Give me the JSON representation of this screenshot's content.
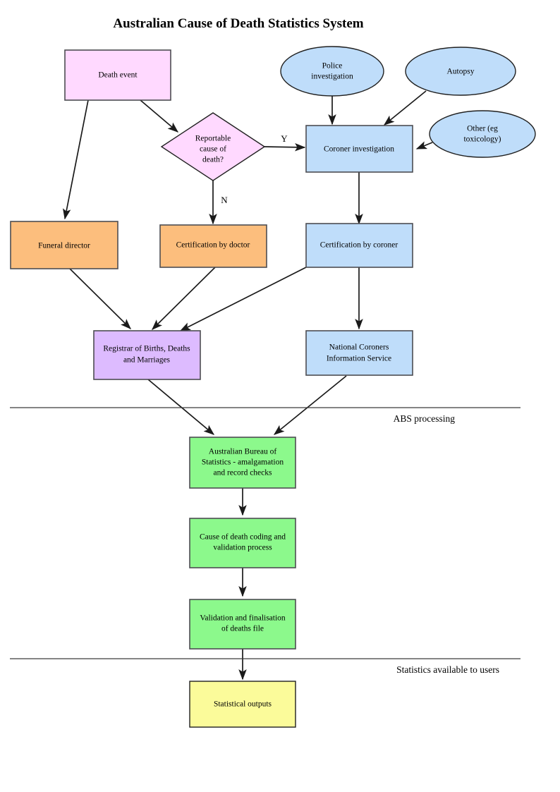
{
  "title": "Australian Cause of Death Statistics System",
  "colors": {
    "pink": "#ffd9ff",
    "blue": "#bfddfa",
    "orange": "#fcbe7d",
    "purple": "#ddbbff",
    "green": "#8cf98c",
    "yellow": "#fbfb9a",
    "border": "#4d4d52",
    "border_dark": "#202020",
    "edge": "#1a1a1a",
    "band_line": "#3a3a3a",
    "text": "#000000"
  },
  "nodes": {
    "death_event": {
      "label": "Death event",
      "shape": "rect",
      "color": "pink"
    },
    "reportable": {
      "label_lines": [
        "Reportable",
        "cause of",
        "death?"
      ],
      "shape": "diamond",
      "color": "pink"
    },
    "police": {
      "label_lines": [
        "Police",
        "investigation"
      ],
      "shape": "ellipse",
      "color": "blue"
    },
    "autopsy": {
      "label": "Autopsy",
      "shape": "ellipse",
      "color": "blue"
    },
    "other": {
      "label_lines": [
        "Other (eg",
        "toxicology)"
      ],
      "shape": "ellipse",
      "color": "blue"
    },
    "coroner_investigation": {
      "label": "Coroner investigation",
      "shape": "rect",
      "color": "blue"
    },
    "funeral_director": {
      "label": "Funeral director",
      "shape": "rect",
      "color": "orange"
    },
    "cert_doctor": {
      "label": "Certification by doctor",
      "shape": "rect",
      "color": "orange"
    },
    "cert_coroner": {
      "label": "Certification by coroner",
      "shape": "rect",
      "color": "blue"
    },
    "registrar": {
      "label_lines": [
        "Registrar of Births, Deaths",
        "and Marriages"
      ],
      "shape": "rect",
      "color": "purple"
    },
    "ncis": {
      "label_lines": [
        "National Coroners",
        "Information Service"
      ],
      "shape": "rect",
      "color": "blue"
    },
    "abs": {
      "label_lines": [
        "Australian Bureau of",
        "Statistics - amalgamation",
        "and record checks"
      ],
      "shape": "rect",
      "color": "green"
    },
    "coding": {
      "label_lines": [
        "Cause of death coding and",
        "validation process"
      ],
      "shape": "rect",
      "color": "green"
    },
    "validation": {
      "label_lines": [
        "Validation and finalisation",
        "of deaths file"
      ],
      "shape": "rect",
      "color": "green"
    },
    "statistical_outputs": {
      "label": "Statistical outputs",
      "shape": "rect",
      "color": "yellow"
    }
  },
  "edge_labels": {
    "yes": "Y",
    "no": "N"
  },
  "band_labels": {
    "abs_processing": "ABS processing",
    "statistics_available": "Statistics available to users"
  }
}
